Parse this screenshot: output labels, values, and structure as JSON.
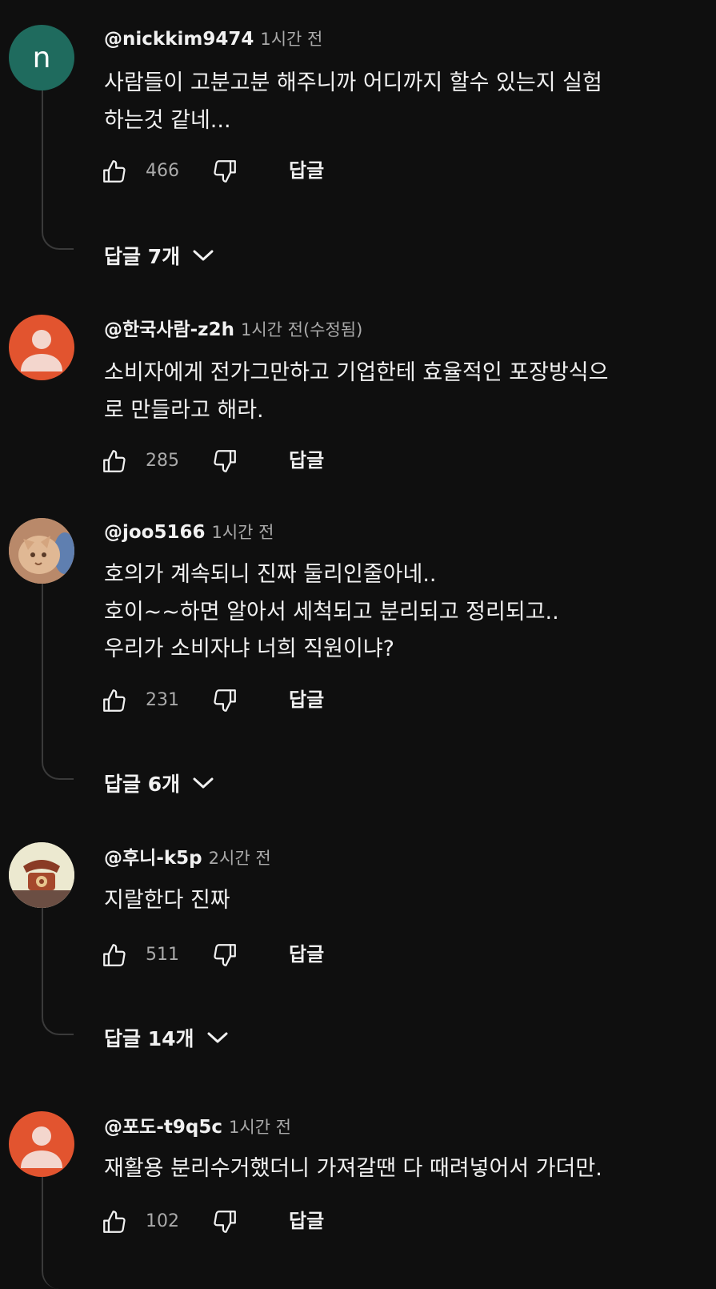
{
  "comments": [
    {
      "author": "@nickkim9474",
      "time": "1시간 전",
      "lines": [
        "사람들이 고분고분 해주니까 어디까지 할수 있는지 실험",
        "하는것 같네..."
      ],
      "likes": "466",
      "reply_label": "답글",
      "avatar_letter": "n",
      "replies_label": "답글 7개"
    },
    {
      "author": "@한국사람-z2h",
      "time": "1시간 전(수정됨)",
      "lines": [
        "소비자에게 전가그만하고 기업한테 효율적인 포장방식으",
        "로 만들라고 해라."
      ],
      "likes": "285",
      "reply_label": "답글"
    },
    {
      "author": "@joo5166",
      "time": "1시간 전",
      "lines": [
        "호의가 계속되니 진짜 둘리인줄아네..",
        "호이~~하면 알아서 세척되고 분리되고 정리되고..",
        "우리가 소비자냐 너희 직원이냐?"
      ],
      "likes": "231",
      "reply_label": "답글",
      "replies_label": "답글 6개"
    },
    {
      "author": "@후니-k5p",
      "time": "2시간 전",
      "lines": [
        "지랄한다 진짜"
      ],
      "likes": "511",
      "reply_label": "답글",
      "replies_label": "답글 14개"
    },
    {
      "author": "@포도-t9q5c",
      "time": "1시간 전",
      "lines": [
        "재활용 분리수거했더니 가져갈땐 다 때려넣어서 가더만."
      ],
      "likes": "102",
      "reply_label": "답글"
    }
  ],
  "colors": {
    "background": "#0f0f0f",
    "text": "#f1f1f1",
    "secondary": "#aaaaaa",
    "avatar_n": "#1f6b5e",
    "avatar_default": "#e2542f"
  }
}
